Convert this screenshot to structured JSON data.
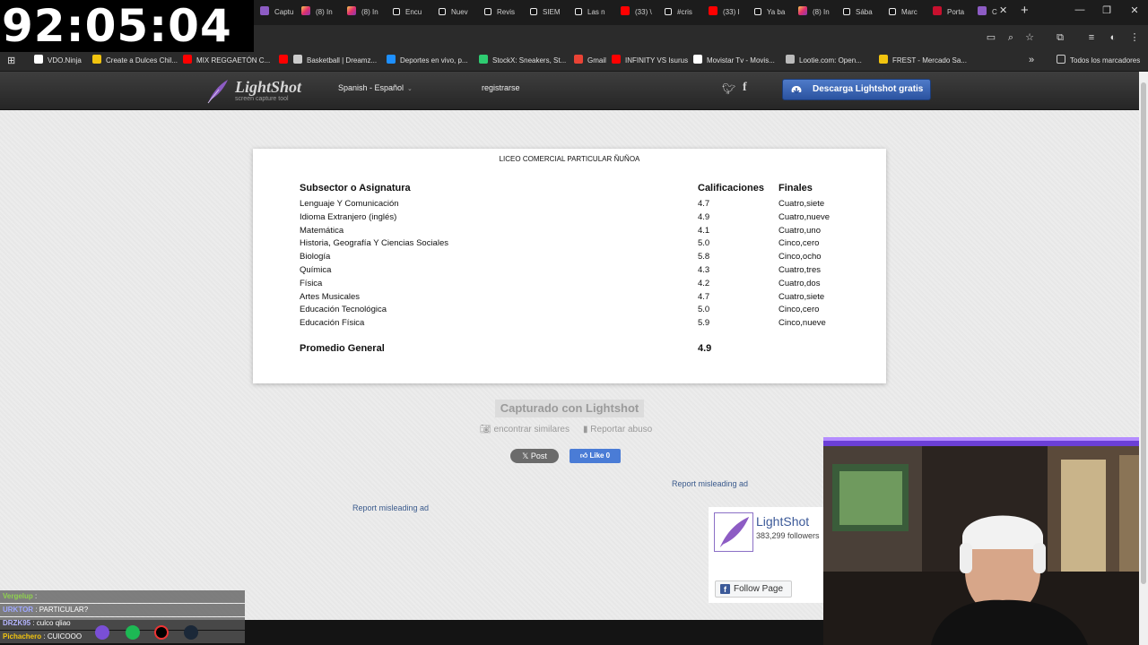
{
  "stream_timer": "92:05:04",
  "tabs": [
    {
      "label": "Captu",
      "icon": "lightshot-icon"
    },
    {
      "label": "(8) In",
      "icon": "instagram-icon"
    },
    {
      "label": "(8) In",
      "icon": "instagram-icon"
    },
    {
      "label": "Encu",
      "icon": "tiktok-icon"
    },
    {
      "label": "Nuev",
      "icon": "tiktok-icon"
    },
    {
      "label": "Revis",
      "icon": "tiktok-icon"
    },
    {
      "label": "SIEM",
      "icon": "tiktok-icon"
    },
    {
      "label": "Las n",
      "icon": "tiktok-icon"
    },
    {
      "label": "(33) \\",
      "icon": "youtube-icon"
    },
    {
      "label": "#cris",
      "icon": "tiktok-icon"
    },
    {
      "label": "(33) I",
      "icon": "youtube-icon"
    },
    {
      "label": "Ya ba",
      "icon": "tiktok-icon"
    },
    {
      "label": "(8) In",
      "icon": "instagram-icon"
    },
    {
      "label": "Sába",
      "icon": "tiktok-icon"
    },
    {
      "label": "Marc",
      "icon": "tiktok-icon"
    },
    {
      "label": "Porta",
      "icon": "portal-icon"
    },
    {
      "label": "C",
      "icon": "lightshot-icon"
    }
  ],
  "bookmarks": [
    {
      "label": "VDO.Ninja",
      "color": "#ffffff"
    },
    {
      "label": "Create a Dulces Chil...",
      "color": "#f1c40f"
    },
    {
      "label": "MIX REGGAETÓN C...",
      "color": "#ff0000"
    },
    {
      "label": "",
      "color": "#ff0000"
    },
    {
      "label": "Basketball | Dreamz...",
      "color": "#cccccc"
    },
    {
      "label": "Deportes en vivo, p...",
      "color": "#1e90ff"
    },
    {
      "label": "StockX: Sneakers, St...",
      "color": "#2ecc71"
    },
    {
      "label": "Gmail",
      "color": "#ea4335"
    },
    {
      "label": "INFINITY VS Isurus",
      "color": "#ff0000"
    },
    {
      "label": "Movistar Tv - Movis...",
      "color": "#ffffff"
    },
    {
      "label": "Lootie.com: Open...",
      "color": "#bbbbbb"
    },
    {
      "label": "FREST - Mercado Sa...",
      "color": "#f1c40f"
    }
  ],
  "bookmarks_more": "»",
  "all_bookmarks": "Todos los marcadores",
  "lightshot": {
    "logo_name": "LightShot",
    "logo_tagline": "screen capture tool",
    "language": "Spanish - Español",
    "register": "registrarse",
    "download_button": "Descarga Lightshot gratis"
  },
  "document": {
    "school": "LICEO COMERCIAL PARTICULAR ÑUÑOA",
    "headers": [
      "Subsector o Asignatura",
      "Calificaciones",
      "Finales"
    ],
    "rows": [
      {
        "subject": "Lenguaje Y Comunicación",
        "grade": "4.7",
        "final": "Cuatro,siete"
      },
      {
        "subject": "Idioma Extranjero (inglés)",
        "grade": "4.9",
        "final": "Cuatro,nueve"
      },
      {
        "subject": "Matemática",
        "grade": "4.1",
        "final": "Cuatro,uno"
      },
      {
        "subject": "Historia, Geografía Y Ciencias Sociales",
        "grade": "5.0",
        "final": "Cinco,cero"
      },
      {
        "subject": "Biología",
        "grade": "5.8",
        "final": "Cinco,ocho"
      },
      {
        "subject": "Química",
        "grade": "4.3",
        "final": "Cuatro,tres"
      },
      {
        "subject": "Física",
        "grade": "4.2",
        "final": "Cuatro,dos"
      },
      {
        "subject": "Artes Musicales",
        "grade": "4.7",
        "final": "Cuatro,siete"
      },
      {
        "subject": "Educación Tecnológica",
        "grade": "5.0",
        "final": "Cinco,cero"
      },
      {
        "subject": "Educación Física",
        "grade": "5.9",
        "final": "Cinco,nueve"
      }
    ],
    "average_label": "Promedio General",
    "average_value": "4.9"
  },
  "captured_with": "Capturado con Lightshot",
  "find_similar": "encontrar similares",
  "report_abuse": "Reportar abuso",
  "x_post": "Post",
  "fb_like": "Like 0",
  "report_ad": "Report misleading ad",
  "fb_widget": {
    "title": "LightShot",
    "followers": "383,299 followers",
    "follow": "Follow Page"
  },
  "chat": [
    {
      "user": "Vergelup",
      "text": ":",
      "color": "#8fd14f"
    },
    {
      "user": "URKTOR",
      "text": ": PARTICULAR?",
      "color": "#9fa8ff"
    },
    {
      "user": "DRZK95",
      "text": ": culco qliao",
      "color": "#b5b5ff"
    },
    {
      "user": "Pichachero",
      "text": ": CUICOOO",
      "color": "#f1c40f"
    }
  ]
}
